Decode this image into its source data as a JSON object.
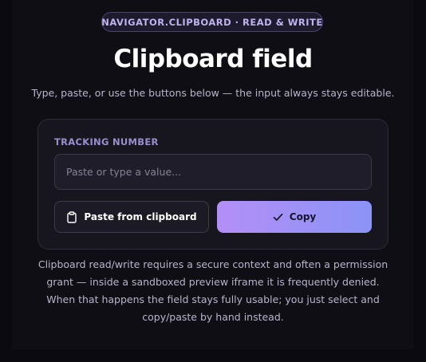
{
  "header": {
    "badge": "NAVIGATOR.CLIPBOARD · READ & WRITE",
    "title": "Clipboard field",
    "subtitle": "Type, paste, or use the buttons below — the input always stays editable."
  },
  "form": {
    "field_label": "TRACKING NUMBER",
    "input_value": "",
    "input_placeholder": "Paste or type a value...",
    "paste_label": "Paste from clipboard",
    "paste_icon": "clipboard-icon",
    "copy_label": "Copy",
    "copy_icon": "check-icon"
  },
  "footer": {
    "note_lines": [
      "Clipboard read/write requires a secure context and often a permission",
      "grant — inside a sandboxed preview iframe it is frequently denied.",
      "When that happens the field stays fully usable; you just select and",
      "copy/paste by hand instead."
    ]
  },
  "colors": {
    "background": "#0b0a10",
    "card": "#17161f",
    "accent_start": "#b38ff7",
    "accent_end": "#8b93f6",
    "label": "#9b8ed0"
  }
}
